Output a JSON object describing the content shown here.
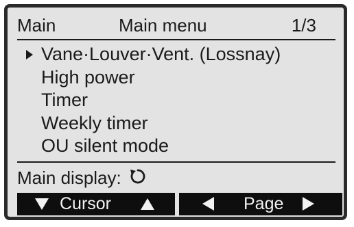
{
  "header": {
    "left_label": "Main",
    "title": "Main menu",
    "page_indicator": "1/3"
  },
  "menu": {
    "selected_index": 0,
    "items": [
      {
        "label": "Vane·Louver·Vent. (Lossnay)"
      },
      {
        "label": "High power"
      },
      {
        "label": "Timer"
      },
      {
        "label": "Weekly timer"
      },
      {
        "label": "OU silent mode"
      }
    ]
  },
  "status": {
    "label": "Main display:",
    "icon": "return-arrow-icon"
  },
  "softkeys": {
    "cursor_label": "Cursor",
    "page_label": "Page"
  },
  "colors": {
    "screen_background": "#e3e3e3",
    "text": "#1a1a1a",
    "softkey_background": "#0e0e0e",
    "softkey_text": "#f2f2f2",
    "bezel": "#2a2a2a"
  }
}
